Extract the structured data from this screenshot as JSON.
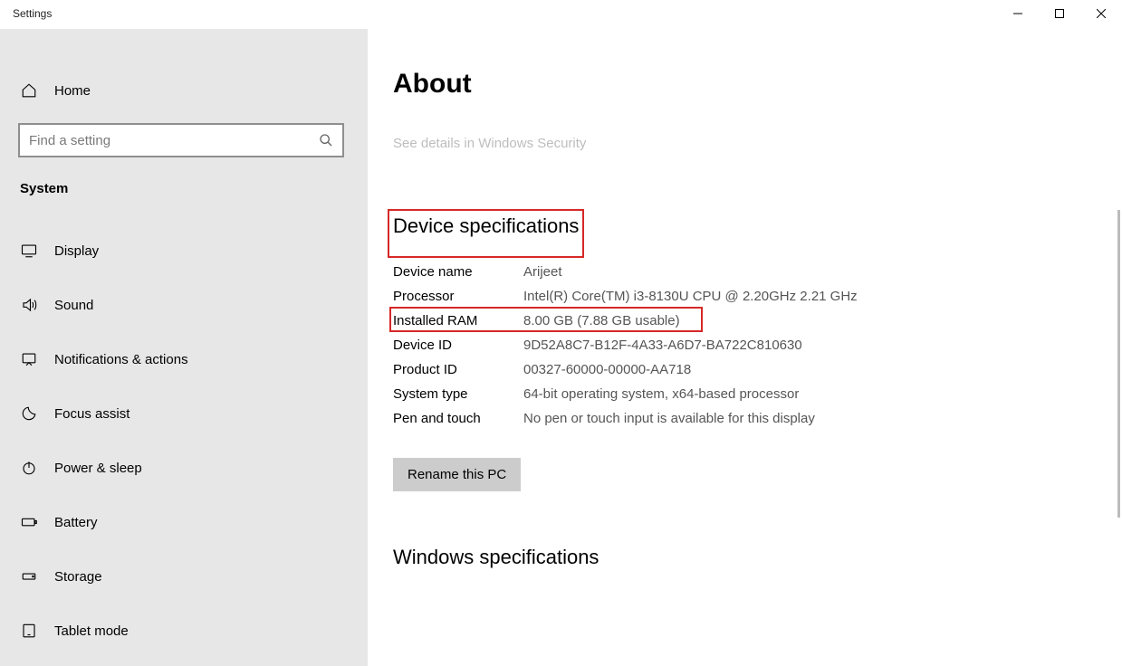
{
  "window": {
    "title": "Settings"
  },
  "sidebar": {
    "home": "Home",
    "search_placeholder": "Find a setting",
    "section": "System",
    "items": [
      {
        "label": "Display"
      },
      {
        "label": "Sound"
      },
      {
        "label": "Notifications & actions"
      },
      {
        "label": "Focus assist"
      },
      {
        "label": "Power & sleep"
      },
      {
        "label": "Battery"
      },
      {
        "label": "Storage"
      },
      {
        "label": "Tablet mode"
      }
    ]
  },
  "content": {
    "title": "About",
    "security_link": "See details in Windows Security",
    "device_spec_heading": "Device specifications",
    "specs": [
      {
        "label": "Device name",
        "value": "Arijeet"
      },
      {
        "label": "Processor",
        "value": "Intel(R) Core(TM) i3-8130U CPU @ 2.20GHz   2.21 GHz"
      },
      {
        "label": "Installed RAM",
        "value": "8.00 GB (7.88 GB usable)"
      },
      {
        "label": "Device ID",
        "value": "9D52A8C7-B12F-4A33-A6D7-BA722C810630"
      },
      {
        "label": "Product ID",
        "value": "00327-60000-00000-AA718"
      },
      {
        "label": "System type",
        "value": "64-bit operating system, x64-based processor"
      },
      {
        "label": "Pen and touch",
        "value": "No pen or touch input is available for this display"
      }
    ],
    "rename_button": "Rename this PC",
    "windows_spec_heading": "Windows specifications"
  }
}
